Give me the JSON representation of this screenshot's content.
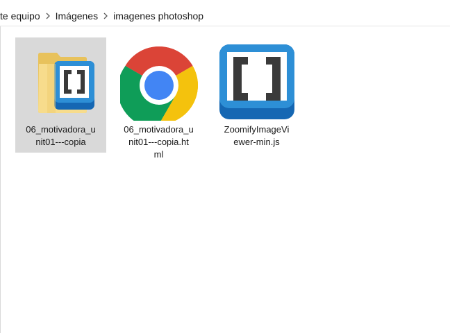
{
  "breadcrumb": {
    "items": [
      "te equipo",
      "Imágenes",
      "imagenes photoshop"
    ]
  },
  "files": [
    {
      "name": "06_motivadora_unit01---copia",
      "label_lines": [
        "06_motivadora_u",
        "nit01---copia"
      ],
      "icon": "folder-with-brackets-icon",
      "selected": true
    },
    {
      "name": "06_motivadora_unit01---copia.html",
      "label_lines": [
        "06_motivadora_u",
        "nit01---copia.ht",
        "ml"
      ],
      "icon": "chrome-icon",
      "selected": false
    },
    {
      "name": "ZoomifyImageViewer-min.js",
      "label_lines": [
        "ZoomifyImageVi",
        "ewer-min.js"
      ],
      "icon": "brackets-icon",
      "selected": false
    }
  ],
  "colors": {
    "selection": "#d9d9d9",
    "brackets_blue": "#2d8fd6",
    "chrome_red": "#db4437",
    "chrome_yellow": "#f4c20d",
    "chrome_green": "#0f9d58",
    "chrome_blue": "#4285f4",
    "folder": "#f5d77a"
  }
}
